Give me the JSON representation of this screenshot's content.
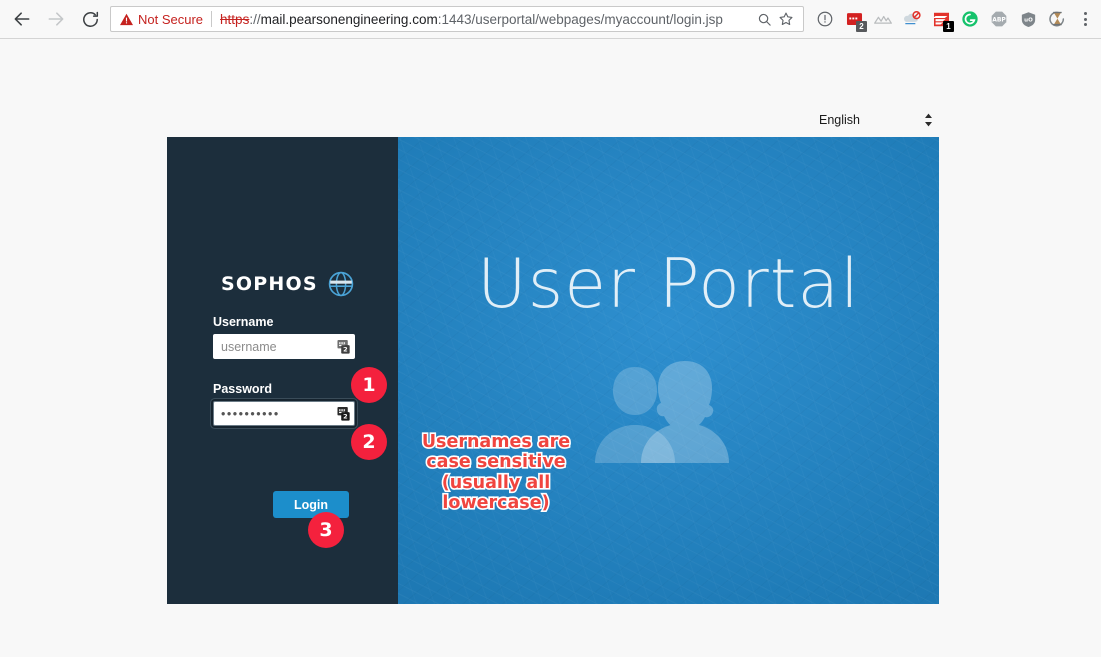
{
  "browser": {
    "nav": {
      "back_icon": "arrow-left-icon",
      "forward_icon": "arrow-right-icon",
      "reload_icon": "reload-icon"
    },
    "omnibox": {
      "security_icon": "warning-triangle-icon",
      "security_label": "Not Secure",
      "url_scheme": "https",
      "url_separator": "://",
      "url_host": "mail.pearsonengineering.com",
      "url_rest": ":1443/userportal/webpages/myaccount/login.jsp",
      "full_url": "https://mail.pearsonengineering.com:1443/userportal/webpages/myaccount/login.jsp",
      "search_icon": "magnifier-icon",
      "bookmark_icon": "star-icon"
    },
    "extensions": [
      {
        "name": "page-info-icon",
        "badge": ""
      },
      {
        "name": "adobe-acrobat-extension-icon",
        "badge": "2"
      },
      {
        "name": "mountains-extension-icon",
        "badge": ""
      },
      {
        "name": "blocked-cloud-extension-icon",
        "badge": ""
      },
      {
        "name": "feedly-extension-icon",
        "badge": "1"
      },
      {
        "name": "grammarly-extension-icon",
        "badge": ""
      },
      {
        "name": "adblock-plus-extension-icon",
        "badge": "ABP"
      },
      {
        "name": "ublock-origin-extension-icon",
        "badge": ""
      },
      {
        "name": "hourglass-extension-icon",
        "badge": ""
      },
      {
        "name": "chrome-menu-icon",
        "badge": ""
      }
    ]
  },
  "page": {
    "language_selector": {
      "icon": "updown-arrows-icon",
      "selected": "English",
      "options": [
        "English"
      ]
    },
    "left_panel": {
      "brand": "SOPHOS",
      "brand_icon": "sophos-globe-icon",
      "username": {
        "label": "Username",
        "value": "",
        "placeholder": "username",
        "fill_icon": "lastpass-fill-icon"
      },
      "password": {
        "label": "Password",
        "value": "••••••••••",
        "placeholder": "",
        "fill_icon": "lastpass-fill-icon"
      },
      "login_label": "Login"
    },
    "right_panel": {
      "title": "User Portal",
      "graphic": "two-users-silhouette-icon"
    },
    "annotations": {
      "badges": [
        {
          "number": "1",
          "target": "username-field"
        },
        {
          "number": "2",
          "target": "password-field"
        },
        {
          "number": "3",
          "target": "login-button"
        }
      ],
      "note": "Usernames are case sensitive (usually all lowercase)"
    }
  },
  "colors": {
    "page_background": "#f8f8f8",
    "dark_panel": "#1c2e3c",
    "blue_panel": "#2080bf",
    "login_button": "#1c8ecb",
    "annotation_red": "#f4213d",
    "note_red": "#f0453f",
    "not_secure_red": "#c5221f"
  }
}
